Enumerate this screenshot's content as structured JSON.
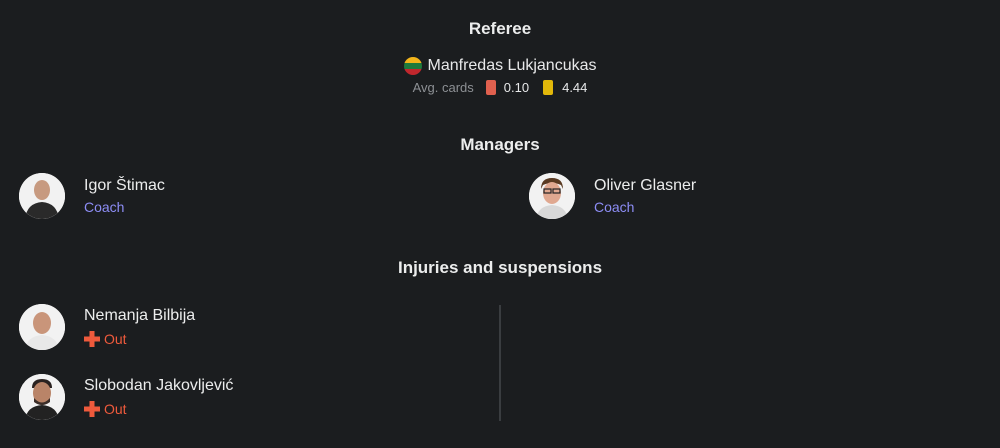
{
  "referee": {
    "title": "Referee",
    "name": "Manfredas Lukjancukas",
    "avg_label": "Avg. cards",
    "red_avg": "0.10",
    "yellow_avg": "4.44",
    "colors": {
      "red_card": "#e0604e",
      "yellow_card": "#e2b80a"
    }
  },
  "managers": {
    "title": "Managers",
    "home": {
      "name": "Igor Štimac",
      "role": "Coach"
    },
    "away": {
      "name": "Oliver Glasner",
      "role": "Coach"
    }
  },
  "injuries": {
    "title": "Injuries and suspensions",
    "players": [
      {
        "name": "Nemanja Bilbija",
        "status": "Out"
      },
      {
        "name": "Slobodan Jakovljević",
        "status": "Out"
      }
    ]
  }
}
